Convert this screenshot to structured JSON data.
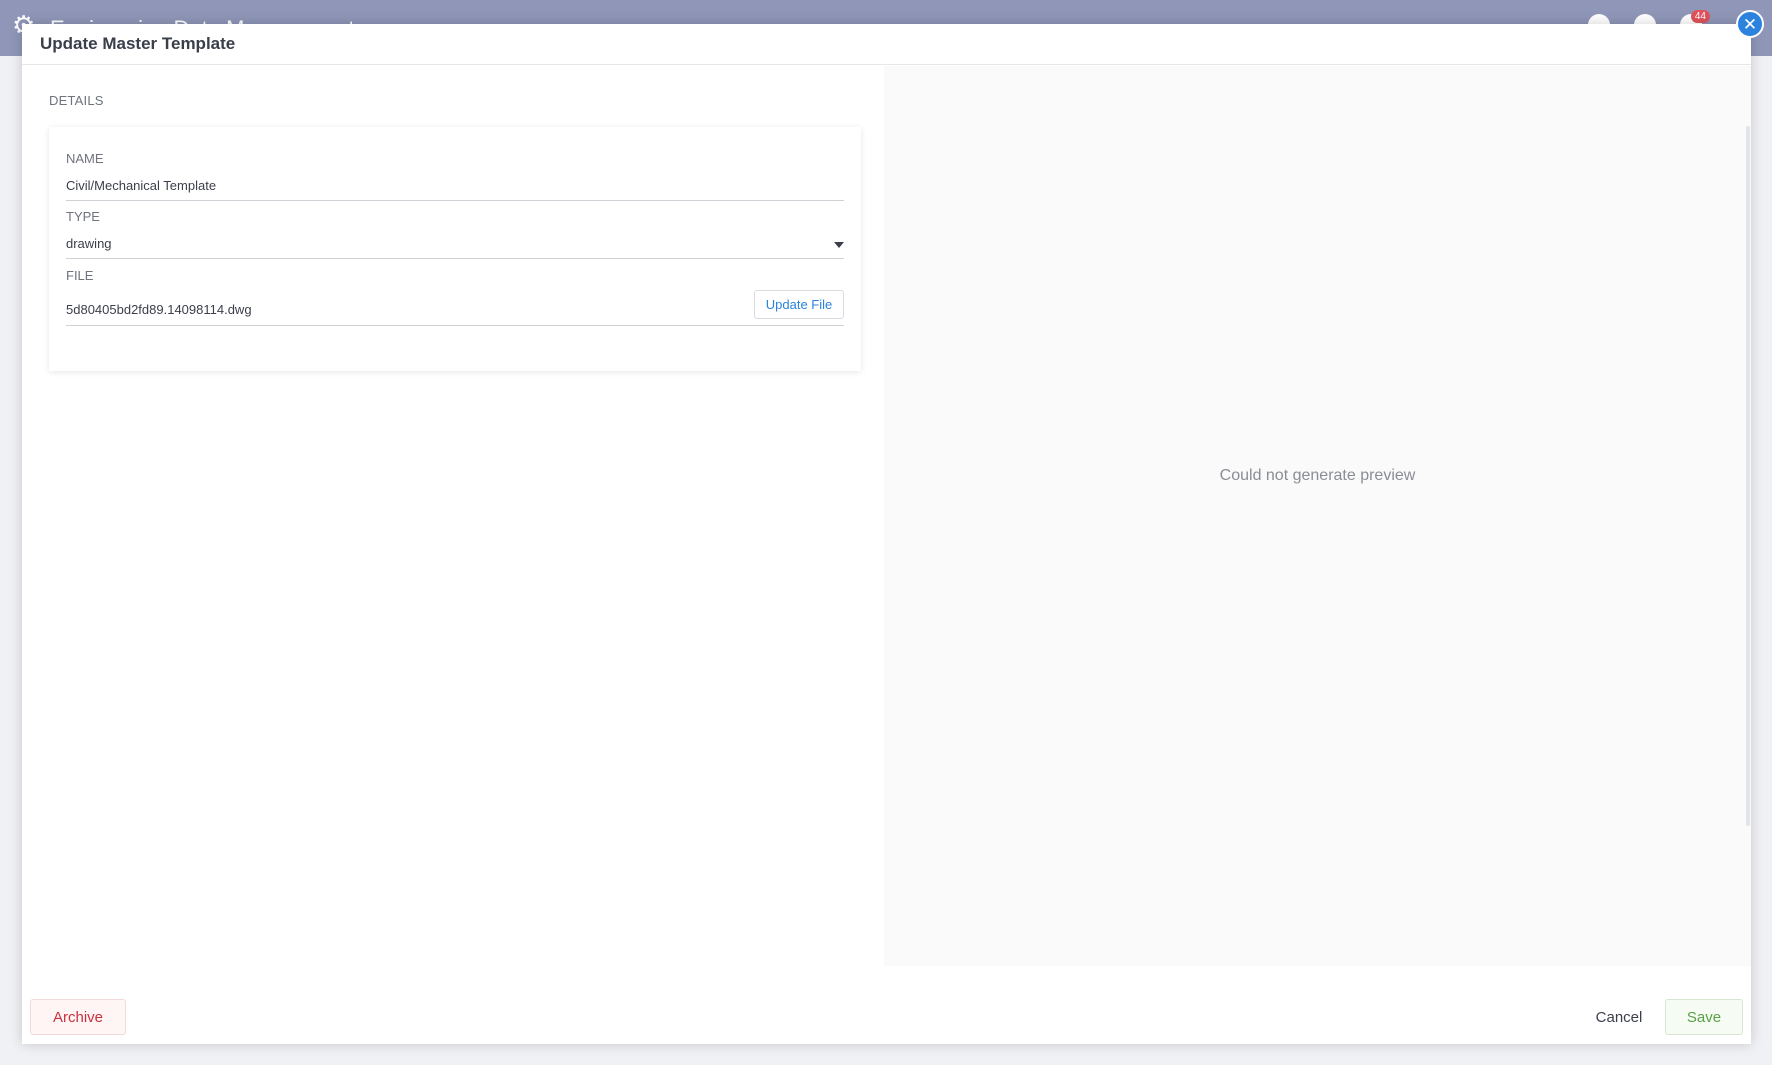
{
  "background": {
    "app_title": "Engineering Data Management",
    "notification_count": "44"
  },
  "modal": {
    "title": "Update Master Template",
    "close_icon": "close-icon",
    "details": {
      "section_label": "DETAILS",
      "name_label": "NAME",
      "name_value": "Civil/Mechanical Template",
      "type_label": "TYPE",
      "type_value": "drawing",
      "file_label": "FILE",
      "file_value": "5d80405bd2fd89.14098114.dwg",
      "update_file_label": "Update File"
    },
    "preview": {
      "message": "Could not generate preview"
    },
    "footer": {
      "archive_label": "Archive",
      "cancel_label": "Cancel",
      "save_label": "Save"
    }
  },
  "colors": {
    "accent": "#2b83dd",
    "danger": "#c8323e",
    "success": "#5aa047",
    "header_bg": "#8f96b8"
  }
}
